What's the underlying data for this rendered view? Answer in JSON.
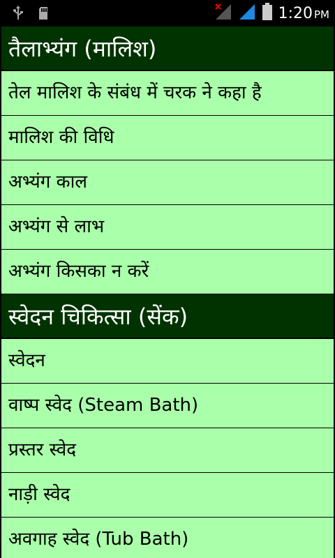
{
  "status_bar": {
    "time": "1:20",
    "ampm": "PM",
    "icons": [
      "usb-icon",
      "sd-card-icon",
      "no-signal-icon",
      "signal-icon",
      "battery-icon"
    ]
  },
  "colors": {
    "section_header_bg": "#003300",
    "item_bg": "#aaffaa"
  },
  "sections": [
    {
      "title": "तैलाभ्यंग (मालिश)",
      "items": [
        "तेल मालिश के संबंध में चरक ने कहा है",
        "मालिश की विधि",
        "अभ्यंग काल",
        "अभ्यंग से लाभ",
        "अभ्यंग किसका न करें"
      ]
    },
    {
      "title": "स्वेदन चिकित्सा (सेंक)",
      "items": [
        "स्वेदन",
        "वाष्प स्वेद (Steam Bath)",
        "प्रस्तर स्वेद",
        "नाड़ी स्वेद",
        "अवगाह स्वेद (Tub Bath)"
      ]
    }
  ]
}
